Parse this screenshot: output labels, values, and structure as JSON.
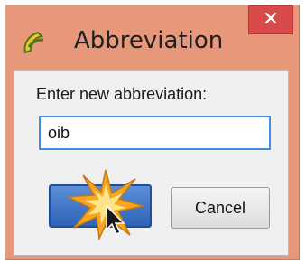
{
  "window": {
    "title": "Abbreviation",
    "icon": "app-logo-icon",
    "close_icon": "close-icon"
  },
  "dialog": {
    "prompt": "Enter new abbreviation:",
    "input_value": "oib",
    "ok_label": "",
    "cancel_label": "Cancel"
  },
  "colors": {
    "frame": "#e8987a",
    "close": "#d94a4a",
    "client": "#f0f0f0",
    "ok_button": "#2f63b6",
    "focus_border": "#3c8fe0"
  }
}
